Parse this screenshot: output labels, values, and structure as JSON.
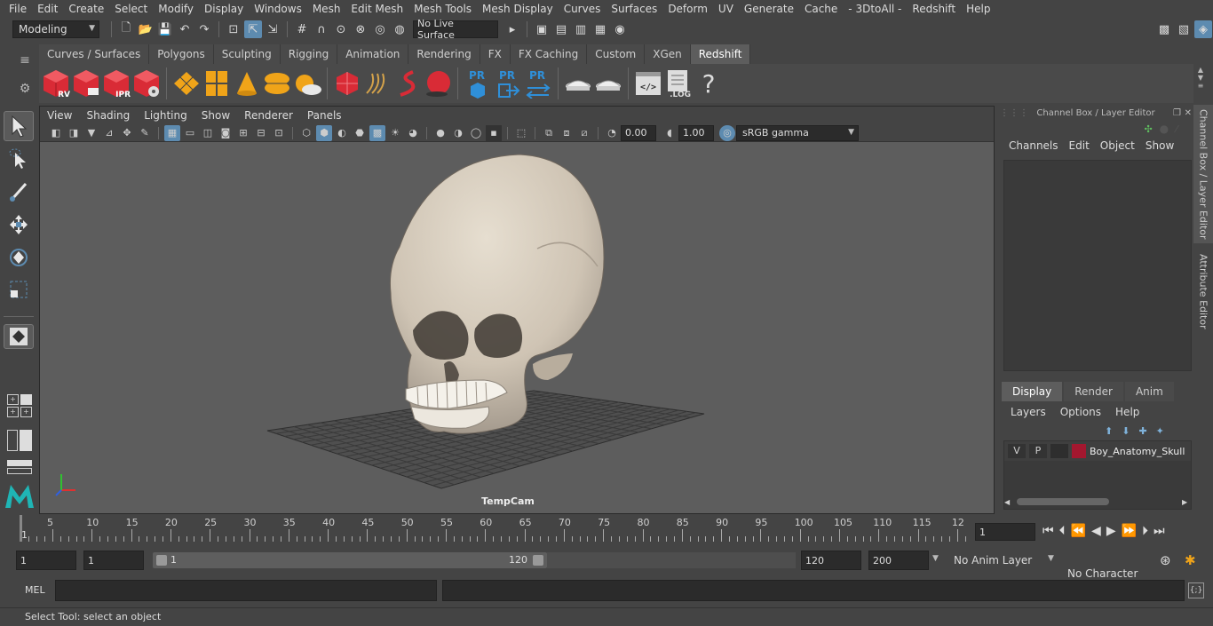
{
  "menubar": [
    "File",
    "Edit",
    "Create",
    "Select",
    "Modify",
    "Display",
    "Windows",
    "Mesh",
    "Edit Mesh",
    "Mesh Tools",
    "Mesh Display",
    "Curves",
    "Surfaces",
    "Deform",
    "UV",
    "Generate",
    "Cache",
    "- 3DtoAll -",
    "Redshift",
    "Help"
  ],
  "status": {
    "mode": "Modeling",
    "live_surface": "No Live Surface"
  },
  "shelf_tabs": [
    "Curves / Surfaces",
    "Polygons",
    "Sculpting",
    "Rigging",
    "Animation",
    "Rendering",
    "FX",
    "FX Caching",
    "Custom",
    "XGen",
    "Redshift"
  ],
  "shelf_active": "Redshift",
  "shelf_labels": {
    "rv": "RV",
    "ipr": "IPR",
    "pr": "PR",
    "log": ".LOG",
    "help": "?"
  },
  "viewport": {
    "menu": [
      "View",
      "Shading",
      "Lighting",
      "Show",
      "Renderer",
      "Panels"
    ],
    "exposure": "0.00",
    "gamma": "1.00",
    "colorspace": "sRGB gamma",
    "camera": "TempCam"
  },
  "channel_box": {
    "title": "Channel Box / Layer Editor",
    "menu": [
      "Channels",
      "Edit",
      "Object",
      "Show"
    ]
  },
  "layer_editor": {
    "tabs": [
      "Display",
      "Render",
      "Anim"
    ],
    "active_tab": "Display",
    "menu": [
      "Layers",
      "Options",
      "Help"
    ],
    "layer": {
      "v": "V",
      "p": "P",
      "name": "Boy_Anatomy_Skull",
      "color": "#a3172f"
    }
  },
  "side_tabs": [
    "Channel Box / Layer Editor",
    "Attribute Editor"
  ],
  "timeline": {
    "ticks": [
      "5",
      "10",
      "15",
      "20",
      "25",
      "30",
      "35",
      "40",
      "45",
      "50",
      "55",
      "60",
      "65",
      "70",
      "75",
      "80",
      "85",
      "90",
      "95",
      "100",
      "105",
      "110",
      "115",
      "12"
    ],
    "start_marker": "1",
    "current_frame": "1"
  },
  "range": {
    "start": "1",
    "playback_start": "1",
    "slider_start": "1",
    "slider_end": "120",
    "playback_end": "120",
    "end": "200",
    "anim_layer": "No Anim Layer",
    "char_set": "No Character Set"
  },
  "cmdline": {
    "lang": "MEL"
  },
  "help_text": "Select Tool: select an object",
  "colors": {
    "accent": "#5d8bb0",
    "redshift_red": "#d92b36",
    "orange": "#f0a419",
    "pr_blue": "#2f8fd8"
  }
}
